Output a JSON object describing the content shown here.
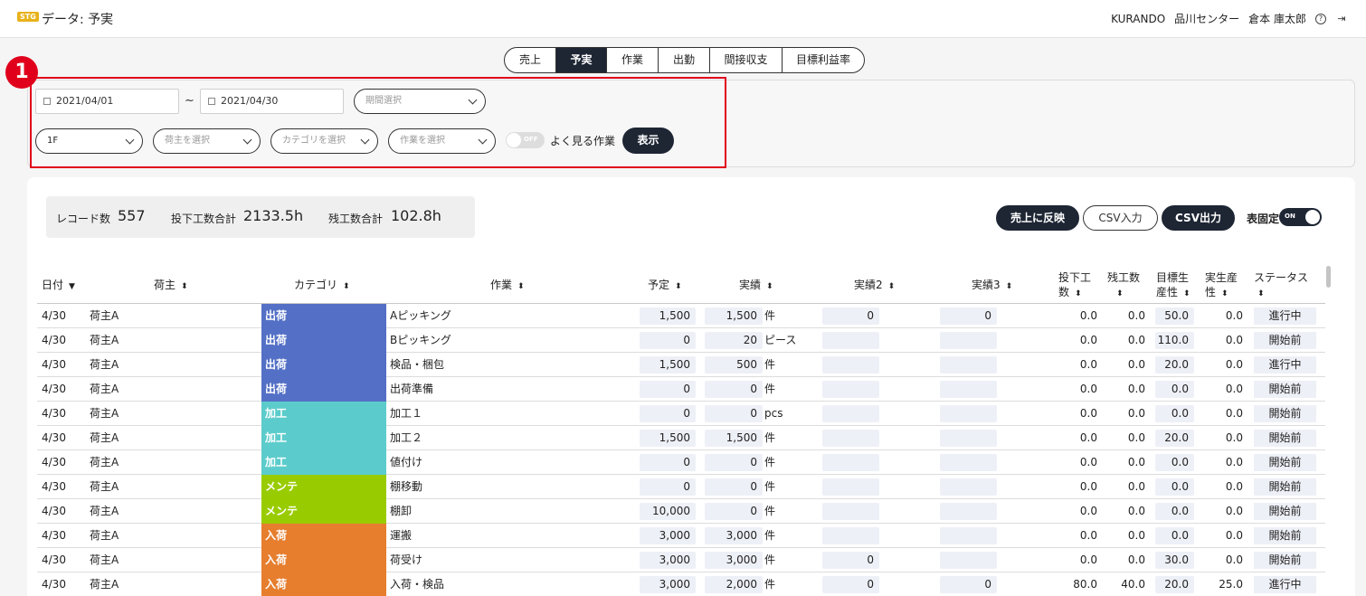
{
  "header": {
    "badge": "STG",
    "title": "データ: 予実",
    "company": "KURANDO",
    "center": "品川センター",
    "user": "倉本 庫太郎",
    "help_glyph": "?",
    "logout_glyph": "⇥"
  },
  "tabs": [
    "売上",
    "予実",
    "作業",
    "出勤",
    "間接収支",
    "目標利益率"
  ],
  "active_tab": "予実",
  "callout_number": "1",
  "filters": {
    "date_from": "2021/04/01",
    "date_to": "2021/04/30",
    "tilde": "~",
    "period_placeholder": "期間選択",
    "floor_value": "1F",
    "shipper_placeholder": "荷主を選択",
    "category_placeholder": "カテゴリを選択",
    "task_placeholder": "作業を選択",
    "toggle_off_text": "OFF",
    "favorite_label": "よく見る作業",
    "show_button": "表示"
  },
  "summary": {
    "record_label": "レコード数",
    "record_value": "557",
    "input_label": "投下工数合計",
    "input_value": "2133.5h",
    "overtime_label": "残工数合計",
    "overtime_value": "102.8h"
  },
  "actions": {
    "reflect_button": "売上に反映",
    "csv_in_button": "CSV入力",
    "csv_out_button": "CSV出力",
    "fix_label": "表固定",
    "toggle_on_text": "ON"
  },
  "table": {
    "headers": {
      "date": "日付",
      "shipper": "荷主",
      "category": "カテゴリ",
      "task": "作業",
      "plan": "予定",
      "actual": "実績",
      "actual2": "実績2",
      "actual3": "実績3",
      "input_l1": "投下工",
      "input_l2": "数",
      "overtime": "残工数",
      "target_l1": "目標生",
      "target_l2": "産性",
      "real_l1": "実生産",
      "real_l2": "性",
      "status": "ステータス"
    },
    "sort_desc_glyph": "▼",
    "sort_both_glyph": "⬍",
    "rows": [
      {
        "date": "4/30",
        "shipper": "荷主A",
        "category": "出荷",
        "cat_color": "#5470c6",
        "task": "Aピッキング",
        "plan": "1,500",
        "actual": "1,500",
        "unit": "件",
        "actual2": "0",
        "actual3": "0",
        "input": "0.0",
        "overtime": "0.0",
        "target": "50.0",
        "real": "0.0",
        "status": "進行中"
      },
      {
        "date": "4/30",
        "shipper": "荷主A",
        "category": "出荷",
        "cat_color": "#5470c6",
        "task": "Bピッキング",
        "plan": "0",
        "actual": "20",
        "unit": "ピース",
        "actual2": "",
        "actual3": "",
        "input": "0.0",
        "overtime": "0.0",
        "target": "110.0",
        "real": "0.0",
        "status": "開始前"
      },
      {
        "date": "4/30",
        "shipper": "荷主A",
        "category": "出荷",
        "cat_color": "#5470c6",
        "task": "検品・梱包",
        "plan": "1,500",
        "actual": "500",
        "unit": "件",
        "actual2": "",
        "actual3": "",
        "input": "0.0",
        "overtime": "0.0",
        "target": "20.0",
        "real": "0.0",
        "status": "進行中"
      },
      {
        "date": "4/30",
        "shipper": "荷主A",
        "category": "出荷",
        "cat_color": "#5470c6",
        "task": "出荷準備",
        "plan": "0",
        "actual": "0",
        "unit": "件",
        "actual2": "",
        "actual3": "",
        "input": "0.0",
        "overtime": "0.0",
        "target": "0.0",
        "real": "0.0",
        "status": "開始前"
      },
      {
        "date": "4/30",
        "shipper": "荷主A",
        "category": "加工",
        "cat_color": "#5bcccb",
        "task": "加工１",
        "plan": "0",
        "actual": "0",
        "unit": "pcs",
        "actual2": "",
        "actual3": "",
        "input": "0.0",
        "overtime": "0.0",
        "target": "0.0",
        "real": "0.0",
        "status": "開始前"
      },
      {
        "date": "4/30",
        "shipper": "荷主A",
        "category": "加工",
        "cat_color": "#5bcccb",
        "task": "加工２",
        "plan": "1,500",
        "actual": "1,500",
        "unit": "件",
        "actual2": "",
        "actual3": "",
        "input": "0.0",
        "overtime": "0.0",
        "target": "20.0",
        "real": "0.0",
        "status": "開始前"
      },
      {
        "date": "4/30",
        "shipper": "荷主A",
        "category": "加工",
        "cat_color": "#5bcccb",
        "task": "値付け",
        "plan": "0",
        "actual": "0",
        "unit": "件",
        "actual2": "",
        "actual3": "",
        "input": "0.0",
        "overtime": "0.0",
        "target": "0.0",
        "real": "0.0",
        "status": "開始前"
      },
      {
        "date": "4/30",
        "shipper": "荷主A",
        "category": "メンテ",
        "cat_color": "#99cc00",
        "task": "棚移動",
        "plan": "0",
        "actual": "0",
        "unit": "件",
        "actual2": "",
        "actual3": "",
        "input": "0.0",
        "overtime": "0.0",
        "target": "0.0",
        "real": "0.0",
        "status": "開始前"
      },
      {
        "date": "4/30",
        "shipper": "荷主A",
        "category": "メンテ",
        "cat_color": "#99cc00",
        "task": "棚卸",
        "plan": "10,000",
        "actual": "0",
        "unit": "件",
        "actual2": "",
        "actual3": "",
        "input": "0.0",
        "overtime": "0.0",
        "target": "0.0",
        "real": "0.0",
        "status": "開始前"
      },
      {
        "date": "4/30",
        "shipper": "荷主A",
        "category": "入荷",
        "cat_color": "#e67e2e",
        "task": "運搬",
        "plan": "3,000",
        "actual": "3,000",
        "unit": "件",
        "actual2": "",
        "actual3": "",
        "input": "0.0",
        "overtime": "0.0",
        "target": "0.0",
        "real": "0.0",
        "status": "開始前"
      },
      {
        "date": "4/30",
        "shipper": "荷主A",
        "category": "入荷",
        "cat_color": "#e67e2e",
        "task": "荷受け",
        "plan": "3,000",
        "actual": "3,000",
        "unit": "件",
        "actual2": "0",
        "actual3": "",
        "input": "0.0",
        "overtime": "0.0",
        "target": "30.0",
        "real": "0.0",
        "status": "開始前"
      },
      {
        "date": "4/30",
        "shipper": "荷主A",
        "category": "入荷",
        "cat_color": "#e67e2e",
        "task": "入荷・検品",
        "plan": "3,000",
        "actual": "2,000",
        "unit": "件",
        "actual2": "0",
        "actual3": "0",
        "input": "80.0",
        "overtime": "40.0",
        "target": "20.0",
        "real": "25.0",
        "status": "進行中"
      }
    ]
  }
}
